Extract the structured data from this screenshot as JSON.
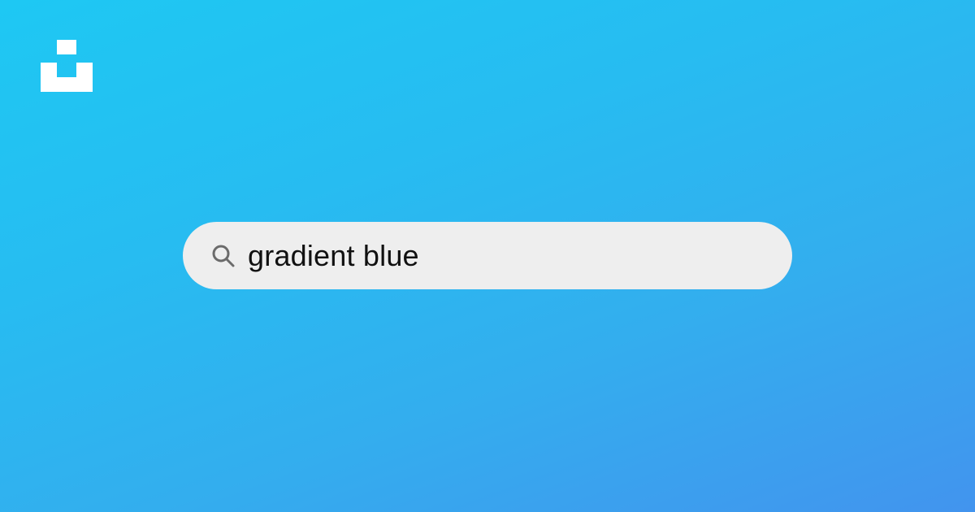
{
  "brand": {
    "logo_icon": "unsplash-logo-icon",
    "logo_color": "#ffffff"
  },
  "background": {
    "gradient_start": "#1ec8f3",
    "gradient_end": "#4294ee"
  },
  "search": {
    "icon": "search-icon",
    "query": "gradient blue",
    "bar_color": "#eeeeee",
    "text_color": "#111111",
    "icon_color": "#6b6b6b"
  }
}
